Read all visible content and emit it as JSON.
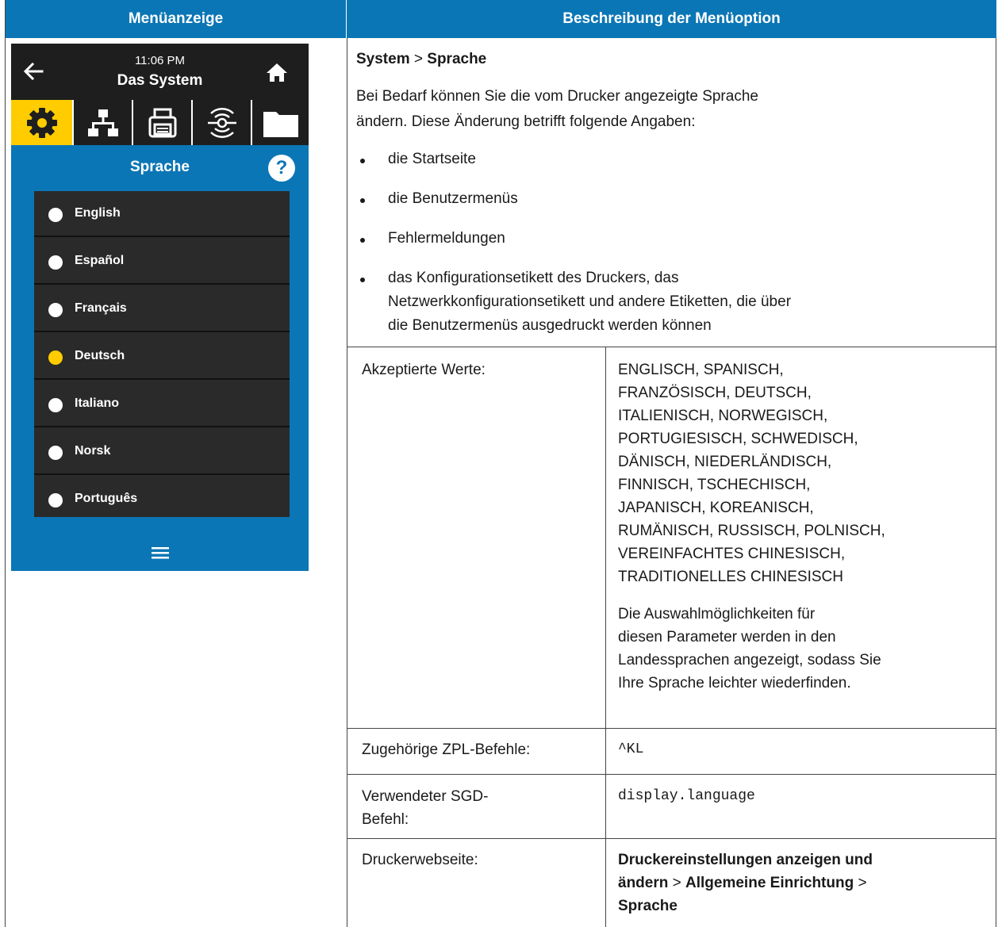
{
  "header": {
    "left": "Menüanzeige",
    "right": "Beschreibung der Menüoption"
  },
  "device": {
    "time": "11:06 PM",
    "title": "Das System",
    "screen_heading": "Sprache",
    "help_glyph": "?",
    "tabs": [
      "gear-icon",
      "network-icon",
      "printer-icon",
      "rfid-icon",
      "folder-icon"
    ],
    "languages": [
      {
        "label": "English",
        "selected": false
      },
      {
        "label": "Español",
        "selected": false
      },
      {
        "label": "Français",
        "selected": false
      },
      {
        "label": "Deutsch",
        "selected": true
      },
      {
        "label": "Italiano",
        "selected": false
      },
      {
        "label": "Norsk",
        "selected": false
      },
      {
        "label": "Português",
        "selected": false
      }
    ],
    "colors": {
      "accent": "#0b76b5",
      "selected": "#ffcc00",
      "dark": "#1e1e1e"
    }
  },
  "description": {
    "path_a": "System",
    "path_sep": " > ",
    "path_b": "Sprache",
    "intro_1": "Bei Bedarf können Sie die vom Drucker angezeigte Sprache",
    "intro_2": "ändern. Diese Änderung betrifft folgende Angaben:",
    "bullets": [
      "die Startseite",
      "die Benutzermenüs",
      "Fehlermeldungen",
      "das Konfigurationsetikett des Druckers, das"
    ],
    "bullet4_line2": "Netzwerkkonfigurationsetikett und andere Etiketten, die über",
    "bullet4_line3": "die Benutzermenüs ausgedruckt werden können"
  },
  "details": {
    "accepted_label": "Akzeptierte Werte:",
    "accepted_values": [
      "ENGLISCH, SPANISCH,",
      "FRANZÖSISCH, DEUTSCH,",
      "ITALIENISCH, NORWEGISCH,",
      "PORTUGIESISCH, SCHWEDISCH,",
      "DÄNISCH, NIEDERLÄNDISCH,",
      "FINNISCH, TSCHECHISCH,",
      "JAPANISCH, KOREANISCH,",
      "RUMÄNISCH, RUSSISCH, POLNISCH,",
      "VEREINFACHTES CHINESISCH,",
      "TRADITIONELLES CHINESISCH"
    ],
    "accepted_note": [
      "Die Auswahlmöglichkeiten für",
      "diesen Parameter werden in den",
      "Landessprachen angezeigt, sodass Sie",
      "Ihre Sprache leichter wiederfinden."
    ],
    "zpl_label": "Zugehörige ZPL-Befehle:",
    "zpl_value": "^KL",
    "sgd_label_1": "Verwendeter SGD-",
    "sgd_label_2": "Befehl:",
    "sgd_value": "display.language",
    "web_label": "Druckerwebseite:",
    "web_bold_1": "Druckereinstellungen anzeigen und",
    "web_bold_2": "ändern",
    "web_sep": " > ",
    "web_bold_3": "Allgemeine Einrichtung",
    "web_sep2": " >",
    "web_bold_4": "Sprache"
  }
}
